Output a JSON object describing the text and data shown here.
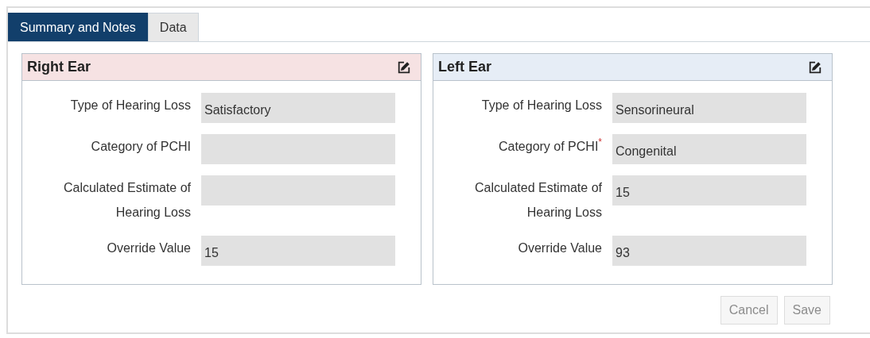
{
  "tabs": [
    {
      "label": "Summary and Notes",
      "selected": true
    },
    {
      "label": "Data",
      "selected": false
    }
  ],
  "panels": [
    {
      "title": "Right Ear",
      "color": "#f6e2e3",
      "fields": [
        {
          "label": "Type of Hearing Loss",
          "value": "Satisfactory"
        },
        {
          "label": "Category of PCHI"
        },
        {
          "label": "Calculated Estimate of Hearing Loss"
        },
        {
          "label": "Override Value",
          "value": "15"
        }
      ]
    },
    {
      "title": "Left Ear",
      "color": "#e6edf6",
      "fields": [
        {
          "label": "Type of Hearing Loss",
          "value": "Sensorineural"
        },
        {
          "label": "Category of PCHI",
          "required_mark": "*",
          "value": "Congenital"
        },
        {
          "label": "Calculated Estimate of Hearing Loss",
          "value": "15"
        },
        {
          "label": "Override Value",
          "value": "93"
        }
      ]
    }
  ],
  "buttons": [
    {
      "label": "Cancel",
      "disabled": true
    },
    {
      "label": "Save",
      "disabled": true
    }
  ]
}
